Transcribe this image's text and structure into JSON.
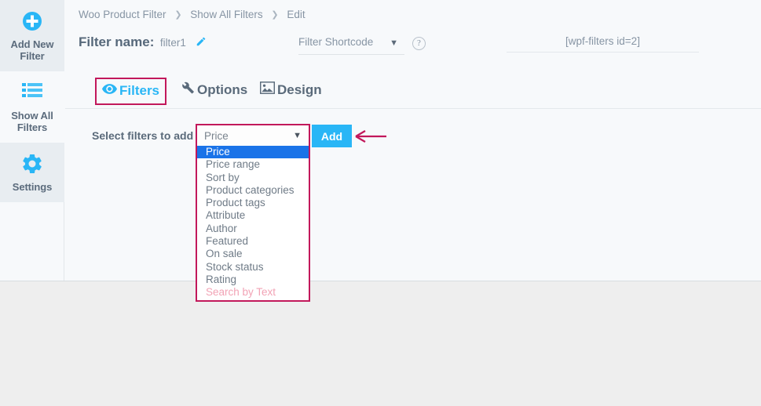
{
  "sidebar": {
    "items": [
      {
        "label": "Add New Filter",
        "icon": "plus-circle-icon",
        "state": "shade"
      },
      {
        "label": "Show All Filters",
        "icon": "list-icon",
        "state": "plain"
      },
      {
        "label": "Settings",
        "icon": "gear-icon",
        "state": "shade"
      }
    ]
  },
  "breadcrumb": {
    "items": [
      "Woo Product Filter",
      "Show All Filters",
      "Edit"
    ],
    "separator": "❯"
  },
  "header": {
    "filter_name_label": "Filter name:",
    "filter_name_value": "filter1",
    "edit_icon": "pencil-icon",
    "shortcode_select_label": "Filter Shortcode",
    "shortcode_caret": "▼",
    "help_icon_label": "?",
    "shortcode_value": "[wpf-filters id=2]"
  },
  "tabs": [
    {
      "label": "Filters",
      "icon": "eye-icon",
      "active": true,
      "highlighted": true
    },
    {
      "label": "Options",
      "icon": "wrench-icon",
      "active": false,
      "highlighted": false
    },
    {
      "label": "Design",
      "icon": "image-icon",
      "active": false,
      "highlighted": false
    }
  ],
  "filter_row": {
    "label": "Select filters to add",
    "selected_value": "Price",
    "caret": "▼",
    "add_button_label": "Add",
    "annotation": "left-arrow-pointing-to-add-button"
  },
  "dropdown_options": [
    {
      "label": "Price",
      "selected": true,
      "disabled": false
    },
    {
      "label": "Price range",
      "selected": false,
      "disabled": false
    },
    {
      "label": "Sort by",
      "selected": false,
      "disabled": false
    },
    {
      "label": "Product categories",
      "selected": false,
      "disabled": false
    },
    {
      "label": "Product tags",
      "selected": false,
      "disabled": false
    },
    {
      "label": "Attribute",
      "selected": false,
      "disabled": false
    },
    {
      "label": "Author",
      "selected": false,
      "disabled": false
    },
    {
      "label": "Featured",
      "selected": false,
      "disabled": false
    },
    {
      "label": "On sale",
      "selected": false,
      "disabled": false
    },
    {
      "label": "Stock status",
      "selected": false,
      "disabled": false
    },
    {
      "label": "Rating",
      "selected": false,
      "disabled": false
    },
    {
      "label": "Search by Text",
      "selected": false,
      "disabled": true
    }
  ],
  "colors": {
    "accent_blue": "#29b6f6",
    "annotation_crimson": "#c2185b",
    "selected_blue": "#1a73e8",
    "text_slate": "#5a6a7a",
    "muted_text": "#8795a4",
    "disabled_pink": "#f2a3b5",
    "panel_bg": "#f7f9fb",
    "page_bg": "#eeeeee"
  }
}
